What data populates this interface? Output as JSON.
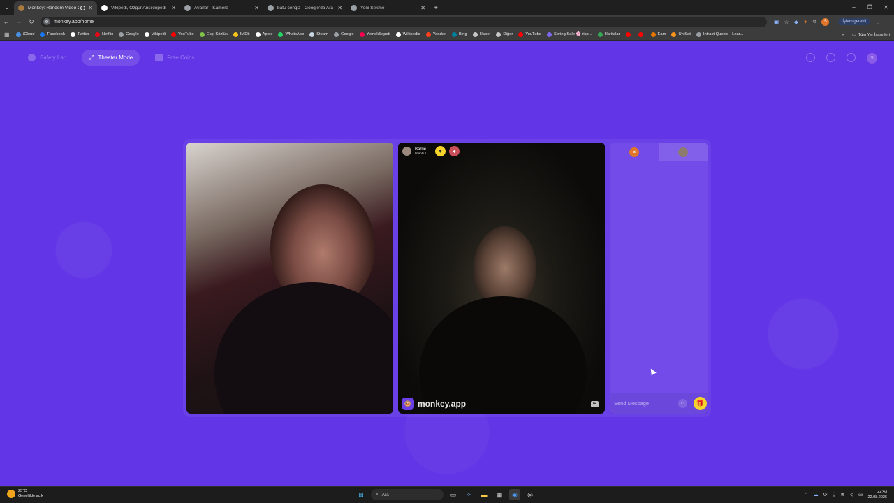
{
  "browser": {
    "tabs": [
      {
        "title": "Monkey: Random Video Chat",
        "active": true,
        "fav_color": "#a77b3f",
        "recording": true
      },
      {
        "title": "Vikipedi, Özgür Ansiklopedi",
        "active": false,
        "fav_color": "#ffffff"
      },
      {
        "title": "Ayarlar - Kamera",
        "active": false,
        "fav_color": "#9aa0a6"
      },
      {
        "title": "batu cengiz - Google'da Ara",
        "active": false,
        "fav_color": "#9aa0a6"
      },
      {
        "title": "Yeni Sekme",
        "active": false,
        "fav_color": "#9aa0a6"
      }
    ],
    "url": "monkey.app/home",
    "profile_label": "İşlem gerekli",
    "profile_initial": "S"
  },
  "bookmarks": [
    {
      "label": "iCloud",
      "color": "#4a90e2"
    },
    {
      "label": "Facebook",
      "color": "#1877f2"
    },
    {
      "label": "Twitter",
      "color": "#ffffff"
    },
    {
      "label": "Netflix",
      "color": "#e50914"
    },
    {
      "label": "Google",
      "color": "#9aa0a6"
    },
    {
      "label": "Vikipedi",
      "color": "#ffffff"
    },
    {
      "label": "YouTube",
      "color": "#ff0000"
    },
    {
      "label": "Ekşi Sözlük",
      "color": "#81c14b"
    },
    {
      "label": "IMDb",
      "color": "#f5c518"
    },
    {
      "label": "Apple",
      "color": "#ffffff"
    },
    {
      "label": "WhatsApp",
      "color": "#25d366"
    },
    {
      "label": "Steam",
      "color": "#c7d5e0"
    },
    {
      "label": "Google",
      "color": "#9aa0a6"
    },
    {
      "label": "YemekSepeti",
      "color": "#fa0050"
    },
    {
      "label": "Wikipedia",
      "color": "#ffffff"
    },
    {
      "label": "Yandex",
      "color": "#fc3f1d"
    },
    {
      "label": "Bing",
      "color": "#00809d"
    },
    {
      "label": "Haber",
      "color": "#c4c7c5"
    },
    {
      "label": "Diğer",
      "color": "#c4c7c5"
    },
    {
      "label": "YouTube",
      "color": "#ff0000"
    },
    {
      "label": "Spring Sale 🌸 risp...",
      "color": "#7b68ee"
    },
    {
      "label": "Haritalar",
      "color": "#34a853"
    },
    {
      "label": "",
      "color": "#ff0000"
    },
    {
      "label": "",
      "color": "#ff0000"
    },
    {
      "label": "Eam",
      "color": "#e37400"
    },
    {
      "label": "UniSat",
      "color": "#f7931a"
    },
    {
      "label": "Intract Quests - Lear...",
      "color": "#9aa0a6"
    }
  ],
  "bookmarks_all": "Tüm Yer İşaretleri",
  "app": {
    "nav": [
      {
        "label": "Safety Lab",
        "active": false
      },
      {
        "label": "Theater Mode",
        "active": true
      },
      {
        "label": "Free Coins",
        "active": false
      }
    ],
    "user_initial": "S",
    "remote": {
      "name": "Barrie",
      "location": "İstanbul"
    },
    "watermark": "monkey.app",
    "chat": {
      "placeholder": "Send Message",
      "self_initial": "S"
    }
  },
  "taskbar": {
    "temperature": "25°C",
    "weather": "Genellikle açık",
    "search": "Ara",
    "time": "22:43",
    "date": "22.08.2026"
  }
}
